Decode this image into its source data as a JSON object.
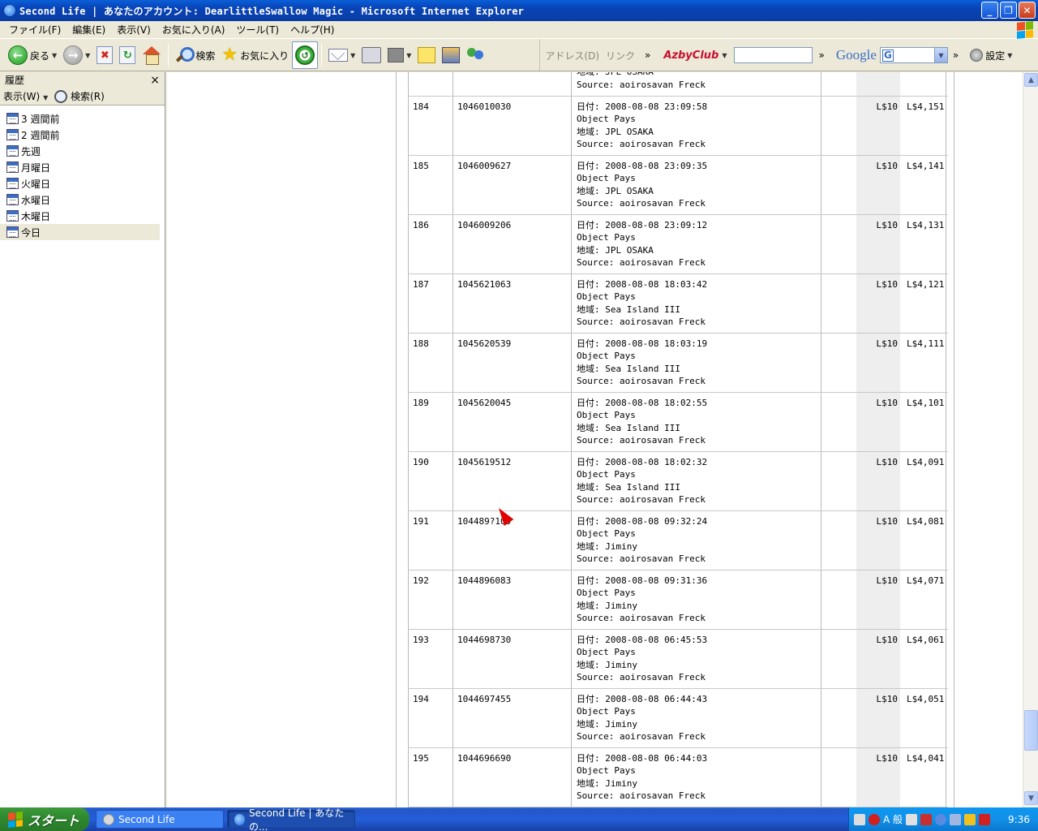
{
  "window": {
    "title": "Second Life | あなたのアカウント: DearlittleSwallow Magic - Microsoft Internet Explorer",
    "minimize": "_",
    "maximize": "❐",
    "close": "✕"
  },
  "menu": [
    "ファイル(F)",
    "編集(E)",
    "表示(V)",
    "お気に入り(A)",
    "ツール(T)",
    "ヘルプ(H)"
  ],
  "toolbar": {
    "back_label": "戻る",
    "search_label": "検索",
    "favorites_label": "お気に入り",
    "address_label": "アドレス(D)",
    "links_label": "リンク",
    "chevron": "»",
    "azby_label": "AzbyClub",
    "google_label": "Google",
    "google_g": "G",
    "settings_label": "設定"
  },
  "sidebar": {
    "title": "履歴",
    "close": "×",
    "view_label": "表示(W)",
    "search_label": "検索(R)",
    "items": [
      {
        "label": "3 週間前"
      },
      {
        "label": "2 週間前"
      },
      {
        "label": "先週"
      },
      {
        "label": "月曜日"
      },
      {
        "label": "火曜日"
      },
      {
        "label": "水曜日"
      },
      {
        "label": "木曜日"
      },
      {
        "label": "今日"
      }
    ]
  },
  "transactions": [
    {
      "num": "",
      "id": "",
      "date": "",
      "type": "",
      "region": "地域: JPL OSAKA",
      "source": "Source: aoirosavan Freck",
      "amount": "",
      "balance": ""
    },
    {
      "num": "184",
      "id": "1046010030",
      "date": "日付: 2008-08-08 23:09:58",
      "type": "Object Pays",
      "region": "地域: JPL OSAKA",
      "source": "Source: aoirosavan Freck",
      "amount": "L$10",
      "balance": "L$4,151"
    },
    {
      "num": "185",
      "id": "1046009627",
      "date": "日付: 2008-08-08 23:09:35",
      "type": "Object Pays",
      "region": "地域: JPL OSAKA",
      "source": "Source: aoirosavan Freck",
      "amount": "L$10",
      "balance": "L$4,141"
    },
    {
      "num": "186",
      "id": "1046009206",
      "date": "日付: 2008-08-08 23:09:12",
      "type": "Object Pays",
      "region": "地域: JPL OSAKA",
      "source": "Source: aoirosavan Freck",
      "amount": "L$10",
      "balance": "L$4,131"
    },
    {
      "num": "187",
      "id": "1045621063",
      "date": "日付: 2008-08-08 18:03:42",
      "type": "Object Pays",
      "region": "地域: Sea Island III",
      "source": "Source: aoirosavan Freck",
      "amount": "L$10",
      "balance": "L$4,121"
    },
    {
      "num": "188",
      "id": "1045620539",
      "date": "日付: 2008-08-08 18:03:19",
      "type": "Object Pays",
      "region": "地域: Sea Island III",
      "source": "Source: aoirosavan Freck",
      "amount": "L$10",
      "balance": "L$4,111"
    },
    {
      "num": "189",
      "id": "1045620045",
      "date": "日付: 2008-08-08 18:02:55",
      "type": "Object Pays",
      "region": "地域: Sea Island III",
      "source": "Source: aoirosavan Freck",
      "amount": "L$10",
      "balance": "L$4,101"
    },
    {
      "num": "190",
      "id": "1045619512",
      "date": "日付: 2008-08-08 18:02:32",
      "type": "Object Pays",
      "region": "地域: Sea Island III",
      "source": "Source: aoirosavan Freck",
      "amount": "L$10",
      "balance": "L$4,091"
    },
    {
      "num": "191",
      "id": "104489?109",
      "date": "日付: 2008-08-08 09:32:24",
      "type": "Object Pays",
      "region": "地域: Jiminy",
      "source": "Source: aoirosavan Freck",
      "amount": "L$10",
      "balance": "L$4,081"
    },
    {
      "num": "192",
      "id": "1044896083",
      "date": "日付: 2008-08-08 09:31:36",
      "type": "Object Pays",
      "region": "地域: Jiminy",
      "source": "Source: aoirosavan Freck",
      "amount": "L$10",
      "balance": "L$4,071"
    },
    {
      "num": "193",
      "id": "1044698730",
      "date": "日付: 2008-08-08 06:45:53",
      "type": "Object Pays",
      "region": "地域: Jiminy",
      "source": "Source: aoirosavan Freck",
      "amount": "L$10",
      "balance": "L$4,061"
    },
    {
      "num": "194",
      "id": "1044697455",
      "date": "日付: 2008-08-08 06:44:43",
      "type": "Object Pays",
      "region": "地域: Jiminy",
      "source": "Source: aoirosavan Freck",
      "amount": "L$10",
      "balance": "L$4,051"
    },
    {
      "num": "195",
      "id": "1044696690",
      "date": "日付: 2008-08-08 06:44:03",
      "type": "Object Pays",
      "region": "地域: Jiminy",
      "source": "Source: aoirosavan Freck",
      "amount": "L$10",
      "balance": "L$4,041"
    }
  ],
  "taskbar": {
    "start_label": "スタート",
    "tasks": [
      {
        "label": "Second Life"
      },
      {
        "label": "Second Life | あなたの..."
      }
    ],
    "ime": "A 般",
    "clock": "9:36"
  },
  "colors": {
    "titlebar": "#0842b5",
    "accent_green": "#2f8a2f",
    "table_grey_column": "#eeeeee"
  }
}
